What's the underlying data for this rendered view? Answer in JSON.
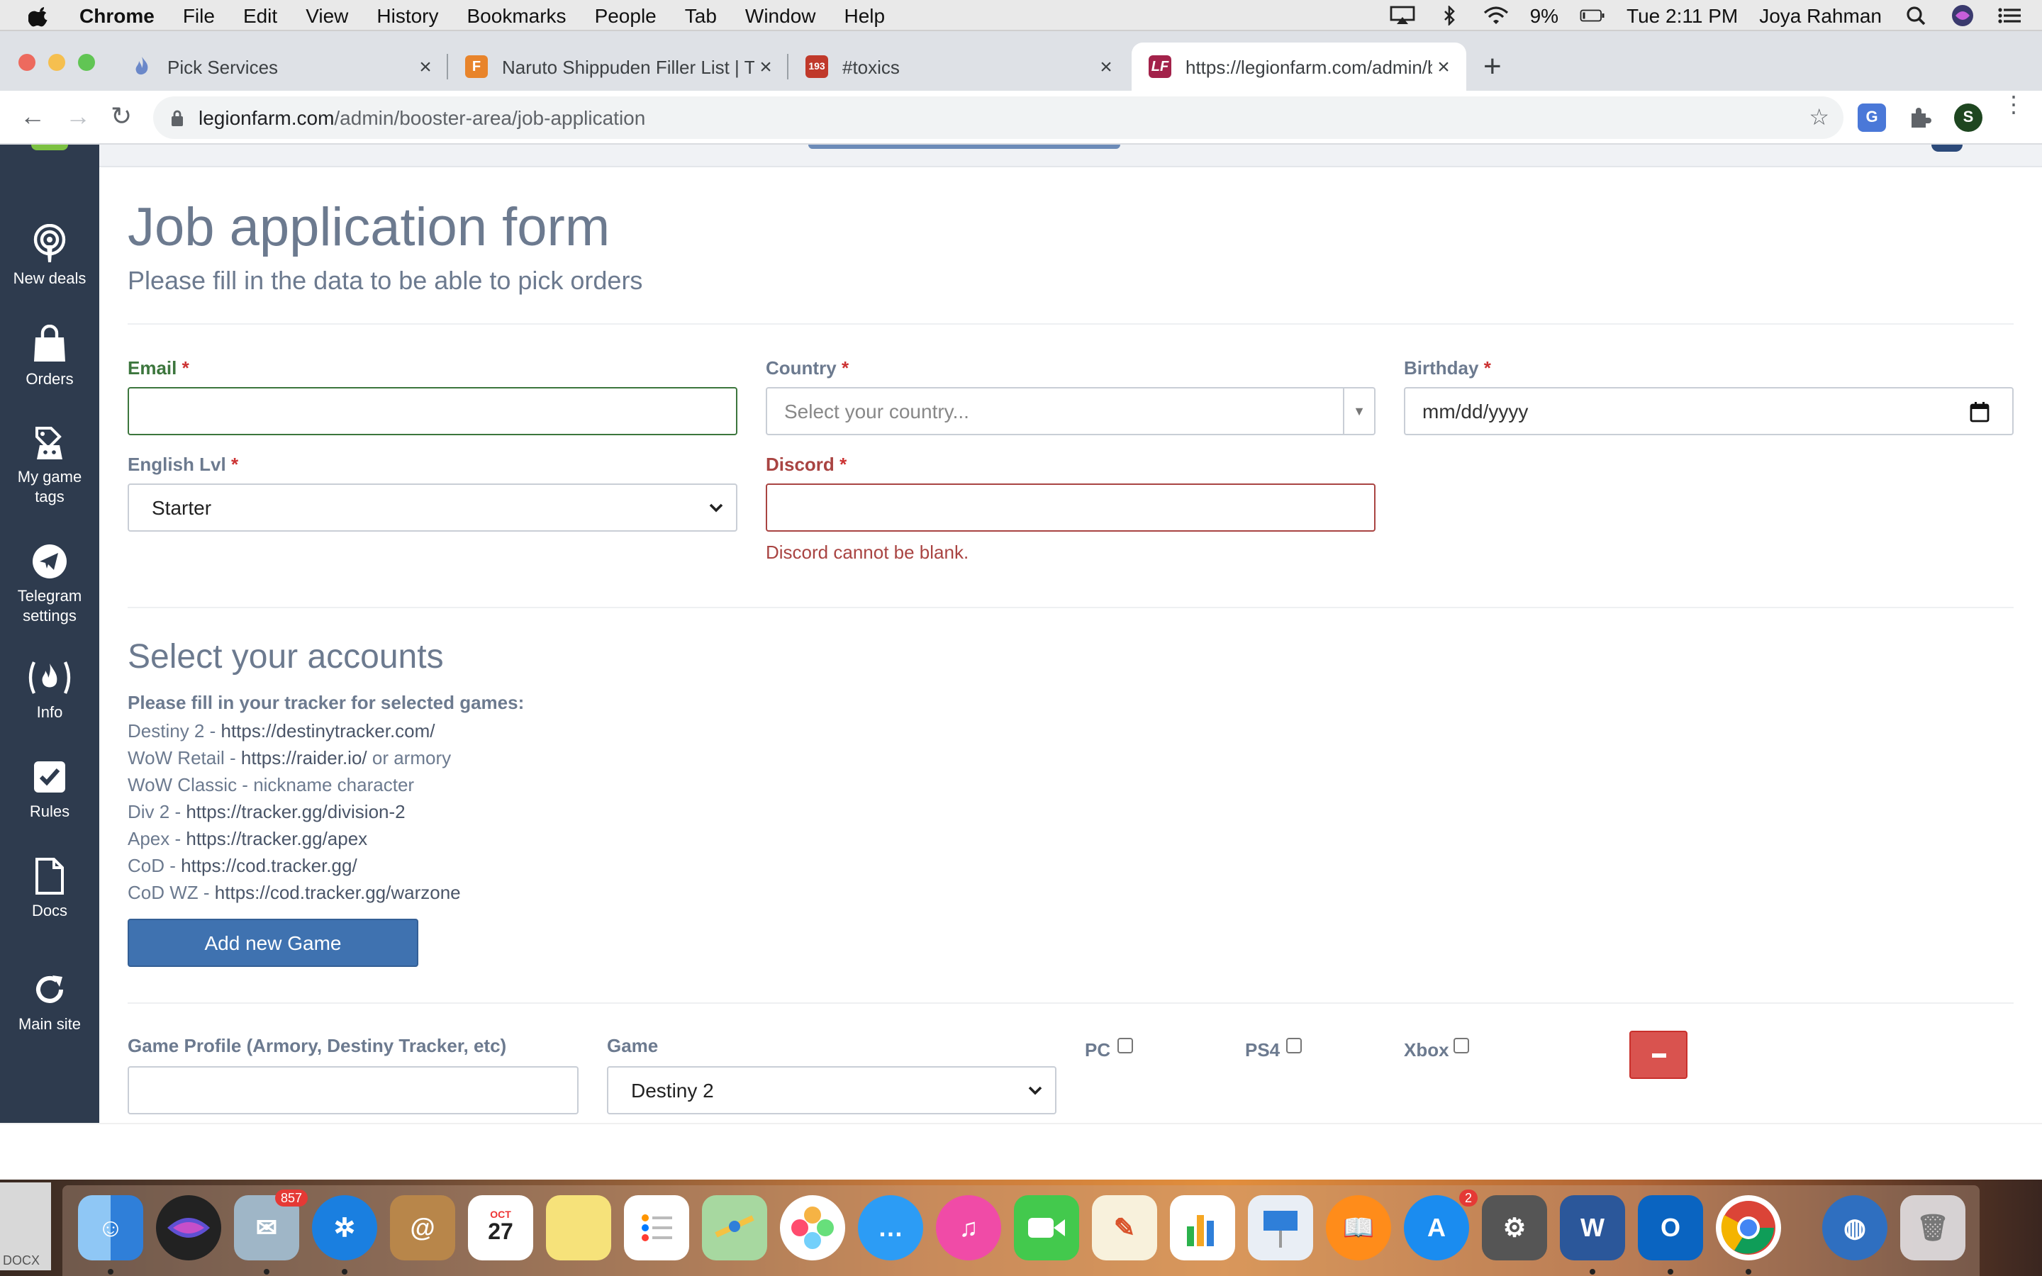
{
  "menubar": {
    "app": "Chrome",
    "items": [
      "File",
      "Edit",
      "View",
      "History",
      "Bookmarks",
      "People",
      "Tab",
      "Window",
      "Help"
    ],
    "battery": "9%",
    "clock": "Tue 2:11 PM",
    "user": "Joya Rahman"
  },
  "tabs": [
    {
      "title": "Pick Services"
    },
    {
      "title": "Naruto Shippuden Filler List | T"
    },
    {
      "title": "#toxics"
    },
    {
      "title": "https://legionfarm.com/admin/b"
    }
  ],
  "tab_badges": {
    "toxics": "193"
  },
  "address": {
    "host": "legionfarm.com",
    "path": "/admin/booster-area/job-application"
  },
  "profile_initial": "S",
  "sidebar": [
    {
      "label": "New deals",
      "icon": "podcast-icon"
    },
    {
      "label": "Orders",
      "icon": "shopping-bag-icon"
    },
    {
      "label": "My game tags",
      "icon": "game-tags-icon"
    },
    {
      "label": "Telegram settings",
      "icon": "telegram-icon"
    },
    {
      "label": "Info",
      "icon": "info-fire-icon"
    },
    {
      "label": "Rules",
      "icon": "checkbox-icon"
    },
    {
      "label": "Docs",
      "icon": "document-icon"
    },
    {
      "label": "Main site",
      "icon": "refresh-icon"
    }
  ],
  "form": {
    "title": "Job application form",
    "subtitle": "Please fill in the data to be able to pick orders",
    "email_label": "Email",
    "email_value": "",
    "country_label": "Country",
    "country_placeholder": "Select your country...",
    "birthday_label": "Birthday",
    "birthday_placeholder": "mm/dd/yyyy",
    "english_label": "English Lvl",
    "english_value": "Starter",
    "discord_label": "Discord",
    "discord_value": "",
    "discord_error": "Discord cannot be blank.",
    "required_mark": "*"
  },
  "accounts": {
    "title": "Select your accounts",
    "tracker_heading": "Please fill in your tracker for selected games:",
    "trackers": [
      {
        "game": "Destiny 2 - ",
        "url": "https://destinytracker.com/",
        "suffix": ""
      },
      {
        "game": "WoW Retail - ",
        "url": "https://raider.io/",
        "suffix": " or armory"
      },
      {
        "game": "WoW Classic - nickname character",
        "url": "",
        "suffix": ""
      },
      {
        "game": "Div 2 - ",
        "url": "https://tracker.gg/division-2",
        "suffix": ""
      },
      {
        "game": "Apex - ",
        "url": "https://tracker.gg/apex",
        "suffix": ""
      },
      {
        "game": "CoD - ",
        "url": "https://cod.tracker.gg/",
        "suffix": ""
      },
      {
        "game": "CoD WZ - ",
        "url": "https://cod.tracker.gg/warzone",
        "suffix": ""
      }
    ],
    "add_button": "Add new Game",
    "profile_label": "Game Profile (Armory, Destiny Tracker, etc)",
    "profile_value": "",
    "game_label": "Game",
    "game_value": "Destiny 2",
    "pc_label": "PC",
    "ps4_label": "PS4",
    "xbox_label": "Xbox",
    "pc_checked": false,
    "ps4_checked": false,
    "xbox_checked": false
  },
  "dock": {
    "mail_badge": "857",
    "calendar_month": "OCT",
    "calendar_day": "27",
    "appstore_badge": "2",
    "file_label": "DOCX"
  },
  "colors": {
    "sidebar": "#2e3b4e",
    "primary": "#3f72b0",
    "danger": "#d9534f",
    "error": "#a94442",
    "success": "#3c763d",
    "heading": "#6c7a8f"
  }
}
